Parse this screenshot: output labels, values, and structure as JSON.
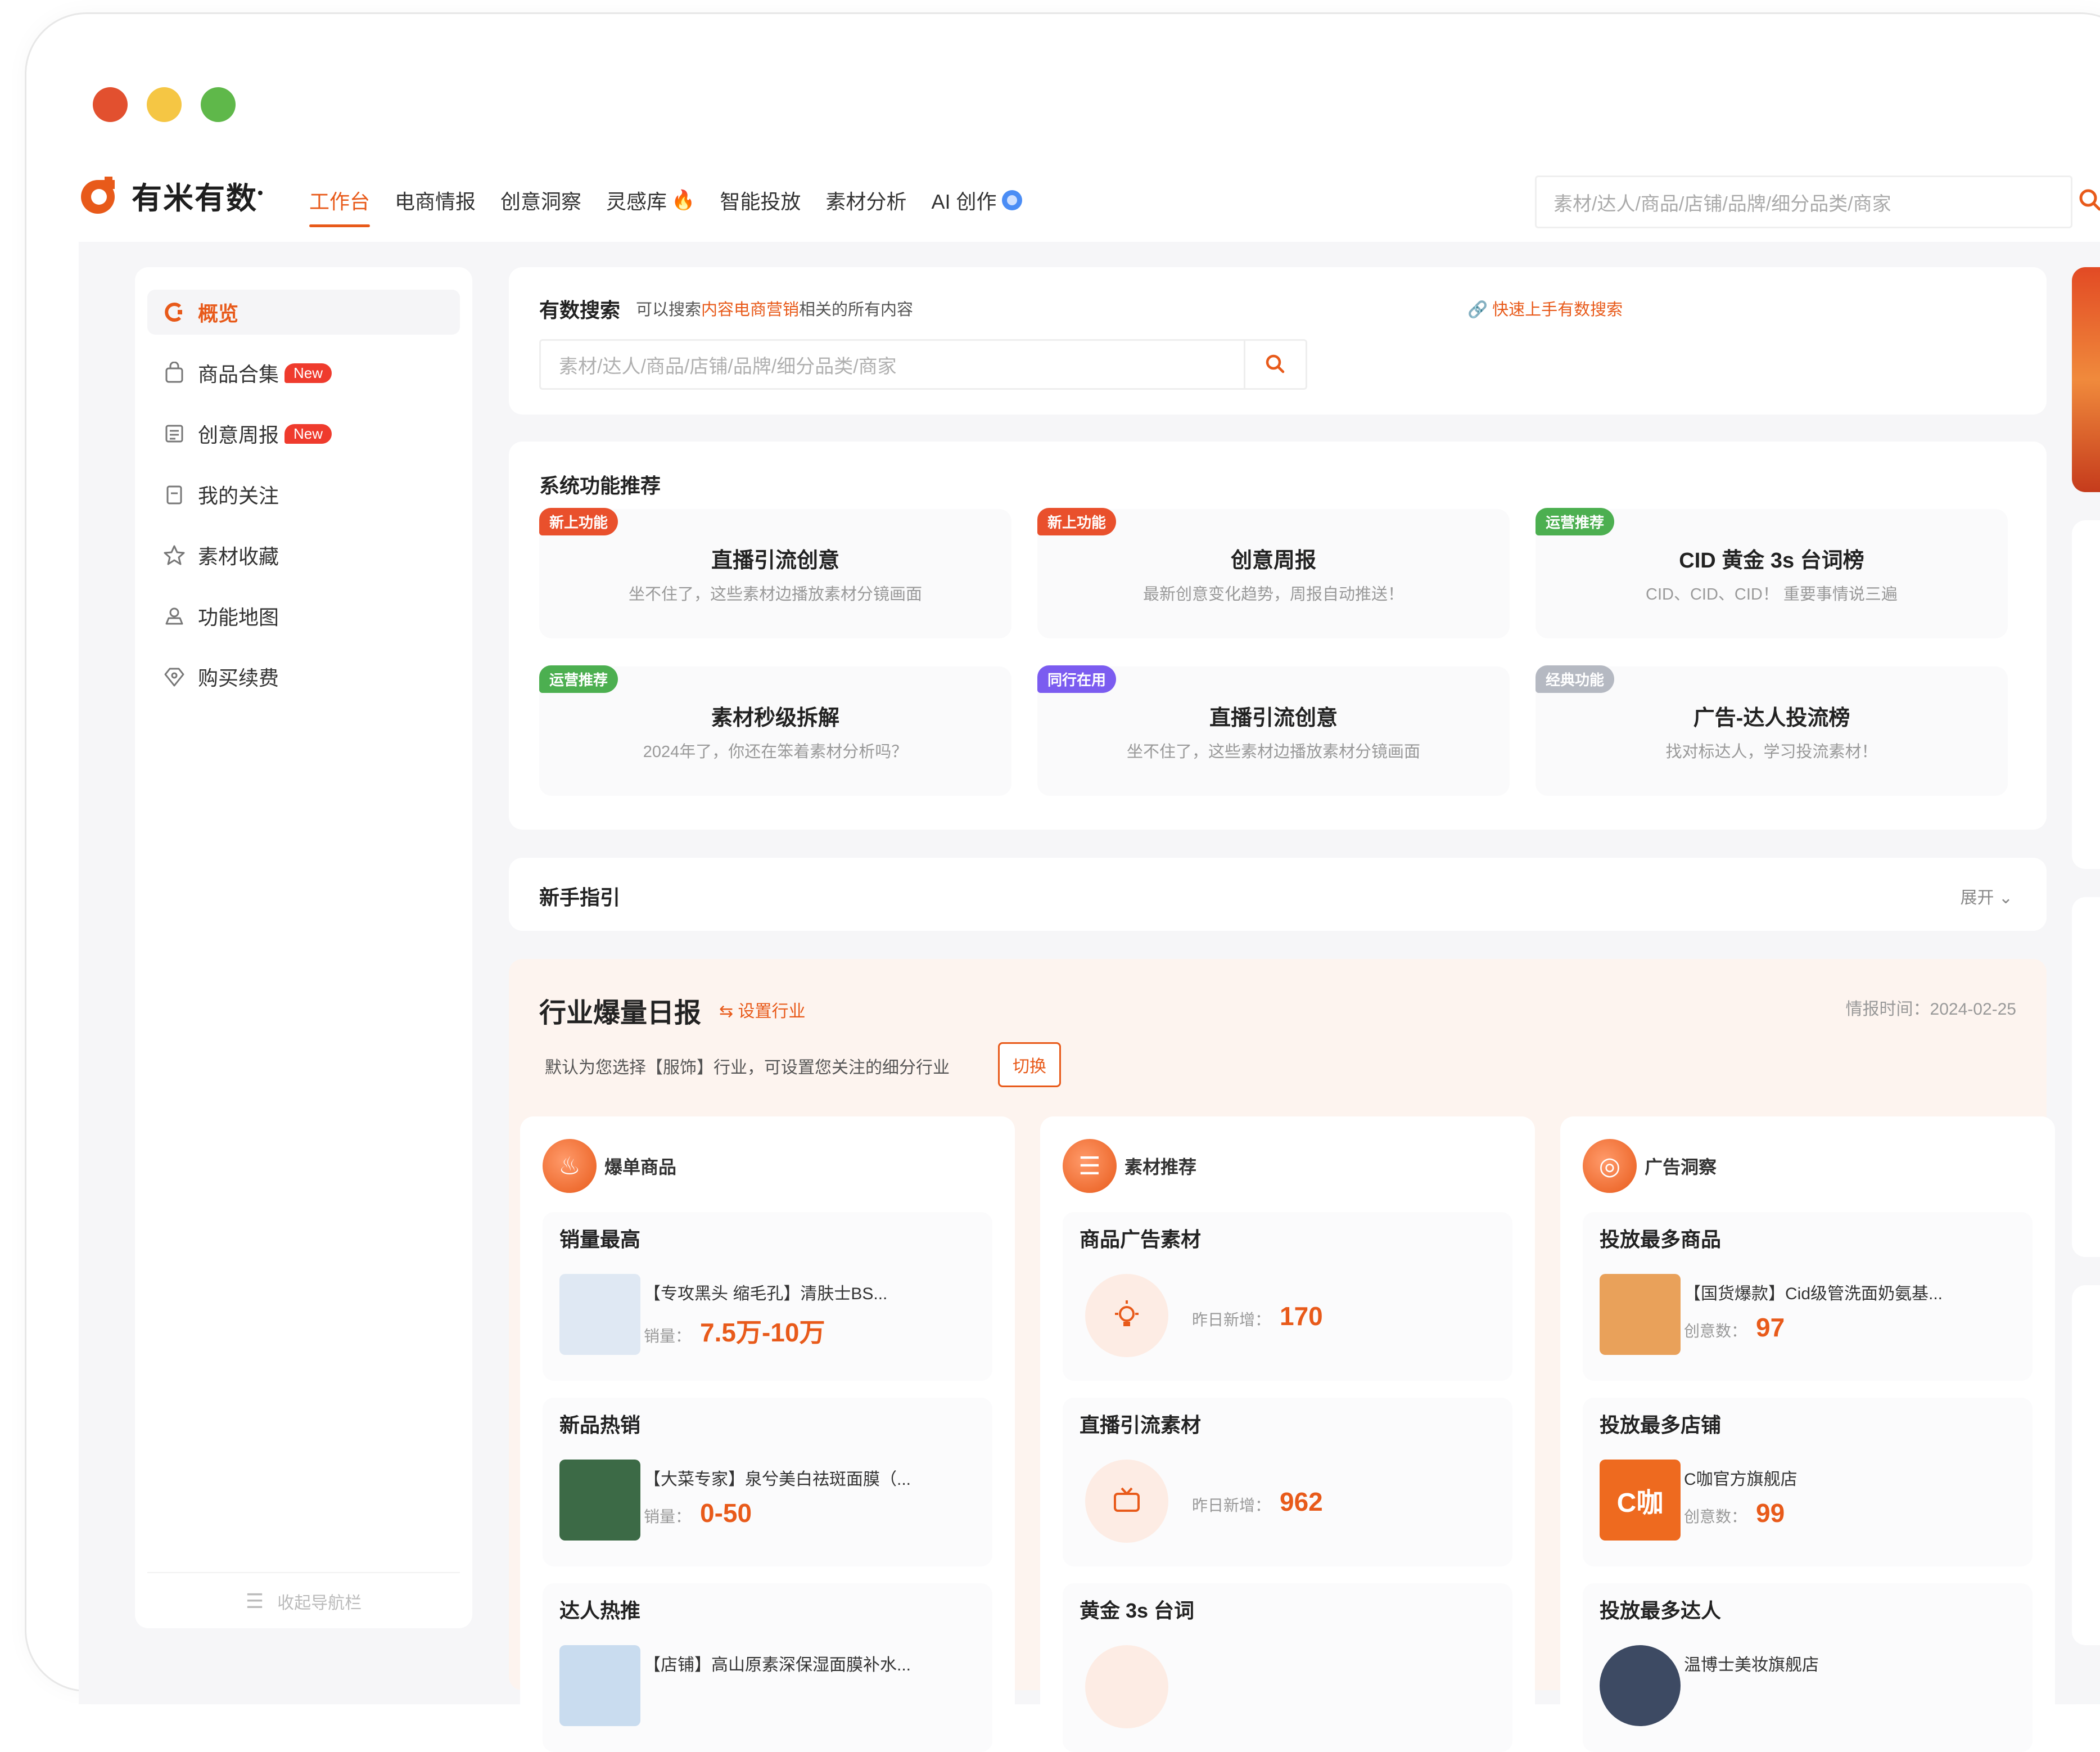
{
  "brand": {
    "name": "有米有数",
    "mark": "•"
  },
  "nav": {
    "items": [
      {
        "label": "工作台",
        "active": true
      },
      {
        "label": "电商情报"
      },
      {
        "label": "创意洞察"
      },
      {
        "label": "灵感库",
        "badge": "fire-icon"
      },
      {
        "label": "智能投放"
      },
      {
        "label": "素材分析"
      },
      {
        "label": "AI 创作",
        "badge": "ai-icon"
      }
    ],
    "search_placeholder": "素材/达人/商品/店铺/品牌/细分品类/商家"
  },
  "sidebar": {
    "items": [
      {
        "label": "概览",
        "icon": "overview-icon",
        "active": true
      },
      {
        "label": "商品合集",
        "icon": "bag-icon",
        "badge": "New"
      },
      {
        "label": "创意周报",
        "icon": "report-icon",
        "badge": "New"
      },
      {
        "label": "我的关注",
        "icon": "bookmark-icon"
      },
      {
        "label": "素材收藏",
        "icon": "star-icon"
      },
      {
        "label": "功能地图",
        "icon": "map-icon"
      },
      {
        "label": "购买续费",
        "icon": "diamond-icon"
      }
    ],
    "collapse_label": "收起导航栏"
  },
  "search_card": {
    "title": "有数搜索",
    "desc_prefix": "可以搜索",
    "desc_highlight": "内容电商营销",
    "desc_suffix": "相关的所有内容",
    "link": "快速上手有数搜索",
    "placeholder": "素材/达人/商品/店铺/品牌/细分品类/商家"
  },
  "recommend": {
    "title": "系统功能推荐",
    "features": [
      {
        "tag": "新上功能",
        "tag_color": "#e9502c",
        "name": "直播引流创意",
        "desc": "坐不住了，这些素材边播放素材分镜画面"
      },
      {
        "tag": "新上功能",
        "tag_color": "#e9502c",
        "name": "创意周报",
        "desc": "最新创意变化趋势，周报自动推送！"
      },
      {
        "tag": "运营推荐",
        "tag_color": "#4caf50",
        "name": "CID 黄金 3s 台词榜",
        "desc": "CID、CID、CID！ 重要事情说三遍"
      },
      {
        "tag": "运营推荐",
        "tag_color": "#4caf50",
        "name": "素材秒级拆解",
        "desc": "2024年了，你还在笨着素材分析吗？"
      },
      {
        "tag": "同行在用",
        "tag_color": "#7b5cf0",
        "name": "直播引流创意",
        "desc": "坐不住了，这些素材边播放素材分镜画面"
      },
      {
        "tag": "经典功能",
        "tag_color": "#b5b9c2",
        "name": "广告-达人投流榜",
        "desc": "找对标达人，学习投流素材！"
      }
    ]
  },
  "guide": {
    "title": "新手指引",
    "expand_label": "展开 ⌄"
  },
  "report": {
    "title": "行业爆量日报",
    "set_label": "设置行业",
    "time_label": "情报时间：2024-02-25",
    "hint": "默认为您选择【服饰】行业，可设置您关注的细分行业",
    "switch_label": "切换",
    "columns": [
      {
        "name": "爆单商品",
        "icon_glyph": "♨",
        "items": [
          {
            "title": "销量最高",
            "text": "【专攻黑头 缩毛孔】清肤士BS...",
            "meta_label": "销量：",
            "value": "7.5万-10万",
            "thumb": "#dfe8f3"
          },
          {
            "title": "新品热销",
            "text": "【大菜专家】泉兮美白祛斑面膜（...",
            "meta_label": "销量：",
            "value": "0-50",
            "thumb": "#3c6a46"
          },
          {
            "title": "达人热推",
            "text": "【店铺】高山原素深保湿面膜补水...",
            "meta_label": "",
            "value": "",
            "thumb": "#c9dcef"
          }
        ]
      },
      {
        "name": "素材推荐",
        "icon_glyph": "☰",
        "items": [
          {
            "title": "商品广告素材",
            "meta_label": "昨日新增：",
            "value": "170",
            "icon": "bulb-icon"
          },
          {
            "title": "直播引流素材",
            "meta_label": "昨日新增：",
            "value": "962",
            "icon": "live-icon"
          },
          {
            "title": "黄金 3s 台词",
            "meta_label": "",
            "value": "",
            "icon": "quote-icon"
          }
        ]
      },
      {
        "name": "广告洞察",
        "icon_glyph": "◎",
        "items": [
          {
            "title": "投放最多商品",
            "text": "【国货爆款】Cid级管洗面奶氨基...",
            "meta_label": "创意数：",
            "value": "97",
            "thumb": "#e9a15a"
          },
          {
            "title": "投放最多店铺",
            "text": "C咖官方旗舰店",
            "meta_label": "创意数：",
            "value": "99",
            "thumb": "#ee6a1f",
            "thumb_text": "C咖"
          },
          {
            "title": "投放最多达人",
            "text": "温博士美妆旗舰店",
            "meta_label": "",
            "value": "",
            "thumb": "#3d4a63"
          }
        ]
      }
    ]
  },
  "colors": {
    "accent": "#e85a1a",
    "danger": "#ef3b2d"
  }
}
